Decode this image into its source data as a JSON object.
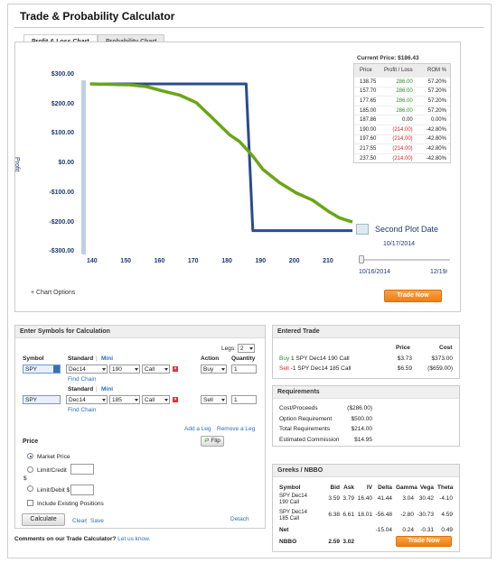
{
  "title": "Trade & Probability Calculator",
  "tabs": [
    {
      "label": "Profit & Loss Chart"
    },
    {
      "label": "Probability Chart"
    }
  ],
  "chart": {
    "y_ticks": [
      "$300.00",
      "$200.00",
      "$100.00",
      "$0.00",
      "-$100.00",
      "-$200.00",
      "-$300.00"
    ],
    "x_ticks": [
      "140",
      "150",
      "160",
      "170",
      "180",
      "190",
      "200",
      "210"
    ],
    "y_axis_label": "Profit",
    "chart_options_label": "+ Chart Options",
    "current_price_label": "Current Price: $186.43",
    "second_plot_date_label": "Second Plot Date",
    "slider_current_date": "10/17/2014",
    "slider_start_date": "10/16/2014",
    "slider_end_date": "12/19/2014",
    "trade_now_label": "Trade Now",
    "colors": {
      "expiration_line": "#2b4b8c",
      "date_line": "#6aa515"
    }
  },
  "chart_data": {
    "type": "line",
    "ylim": [
      -300,
      300
    ],
    "xlim": [
      137,
      217
    ],
    "series": [
      {
        "points": [
          [
            138,
            286
          ],
          [
            185,
            286
          ],
          [
            187,
            -214
          ],
          [
            217,
            -214
          ]
        ]
      },
      {
        "points": [
          [
            138,
            286
          ],
          [
            150,
            283
          ],
          [
            155,
            277
          ],
          [
            160,
            262
          ],
          [
            165,
            248
          ],
          [
            170,
            222
          ],
          [
            175,
            168
          ],
          [
            180,
            113
          ],
          [
            183,
            90
          ],
          [
            187,
            40
          ],
          [
            190,
            -5
          ],
          [
            195,
            -50
          ],
          [
            200,
            -85
          ],
          [
            205,
            -110
          ],
          [
            210,
            -150
          ],
          [
            213,
            -170
          ],
          [
            217,
            -185
          ]
        ]
      }
    ]
  },
  "price_table": {
    "headers": [
      "Price",
      "Profit / Loss",
      "ROM %"
    ],
    "rows": [
      {
        "price": "138.75",
        "pl": "286.00",
        "rom": "57.20%",
        "neg": false
      },
      {
        "price": "157.70",
        "pl": "286.00",
        "rom": "57.20%",
        "neg": false
      },
      {
        "price": "177.65",
        "pl": "286.00",
        "rom": "57.20%",
        "neg": false
      },
      {
        "price": "185.00",
        "pl": "286.00",
        "rom": "57.20%",
        "neg": false
      },
      {
        "price": "187.86",
        "pl": "0.00",
        "rom": "0.00%",
        "neg": null
      },
      {
        "price": "190.00",
        "pl": "(214.00)",
        "rom": "-42.80%",
        "neg": true
      },
      {
        "price": "197.60",
        "pl": "(214.00)",
        "rom": "-42.80%",
        "neg": true
      },
      {
        "price": "217.55",
        "pl": "(214.00)",
        "rom": "-42.80%",
        "neg": true
      },
      {
        "price": "237.50",
        "pl": "(214.00)",
        "rom": "-42.80%",
        "neg": true
      }
    ]
  },
  "symbols_panel": {
    "title": "Enter Symbols for Calculation",
    "legs_label": "Legs:",
    "legs_value": "2",
    "symbol_header": "Symbol",
    "standard_label": "Standard",
    "mini_label": "Mini",
    "action_header": "Action",
    "quantity_header": "Quantity",
    "find_chain": "Find Chain",
    "legs": [
      {
        "symbol": "SPY",
        "expiry": "Dec14",
        "strike": "190",
        "type": "Call",
        "action": "Buy",
        "qty": "1"
      },
      {
        "symbol": "SPY",
        "expiry": "Dec14",
        "strike": "185",
        "type": "Call",
        "action": "Sell",
        "qty": "1"
      }
    ],
    "add_leg": "Add a Leg",
    "remove_leg": "Remove a Leg",
    "flip": "Flip",
    "price_header": "Price",
    "market_price": "Market Price",
    "limit_credit": "Limit/Credit",
    "dollar": "$",
    "limit_debit": "Limit/Debit $",
    "include_existing": "Include Existing Positions",
    "calculate": "Calculate",
    "clear": "Clear",
    "save": "Save",
    "sep": "|",
    "detach": "Detach"
  },
  "comments": {
    "text": "Comments on our Trade Calculator?",
    "link": "Let us know."
  },
  "entered_trade": {
    "title": "Entered Trade",
    "headers": [
      "Price",
      "Cost"
    ],
    "rows": [
      {
        "action": "Buy",
        "desc": "1 SPY Dec14 190 Call",
        "price": "$3.73",
        "cost": "$373.00",
        "neg": false
      },
      {
        "action": "Sell",
        "desc": "-1 SPY Dec14 185 Call",
        "price": "$6.59",
        "cost": "($659.00)",
        "neg": true
      }
    ]
  },
  "requirements": {
    "title": "Requirements",
    "rows": [
      {
        "label": "Cost/Proceeds",
        "value": "($286.00)",
        "neg": true
      },
      {
        "label": "Option Requirement",
        "value": "$500.00",
        "neg": false
      },
      {
        "label": "Total Requirements",
        "value": "$214.00",
        "neg": false
      },
      {
        "label": "Estimated Commission",
        "value": "$14.95",
        "neg": false
      }
    ]
  },
  "greeks": {
    "title": "Greeks / NBBO",
    "headers": [
      "Symbol",
      "Bid",
      "Ask",
      "IV",
      "Delta",
      "Gamma",
      "Vega",
      "Theta"
    ],
    "rows": [
      {
        "symbol1": "SPY Dec14",
        "symbol2": "190 Call",
        "bid": "3.59",
        "ask": "3.79",
        "iv": "16.40",
        "delta": "41.44",
        "gamma": "3.04",
        "vega": "30.42",
        "theta": "-4.10"
      },
      {
        "symbol1": "SPY Dec14",
        "symbol2": "185 Call",
        "bid": "6.38",
        "ask": "6.61",
        "iv": "18.01",
        "delta": "-56.48",
        "gamma": "-2.80",
        "vega": "-30.73",
        "theta": "4.59"
      }
    ],
    "net": {
      "label": "Net",
      "delta": "-15.04",
      "gamma": "0.24",
      "vega": "-0.31",
      "theta": "0.49"
    },
    "nbbo": {
      "label": "NBBO",
      "bid": "2.59",
      "ask": "3.02"
    },
    "trade_now_label": "Trade Now"
  }
}
